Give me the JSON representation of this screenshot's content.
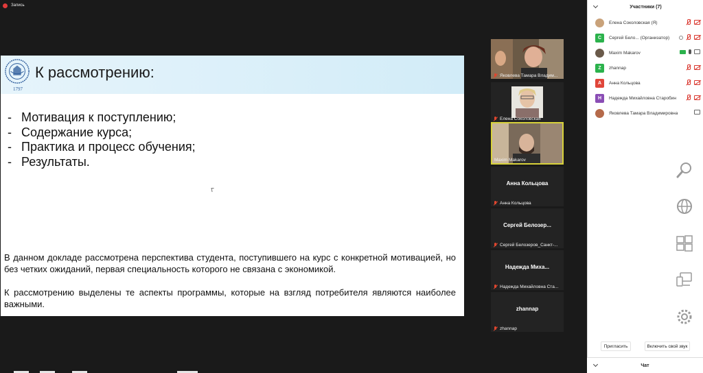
{
  "recording": {
    "label": "Запись",
    "color": "#e03a3a"
  },
  "slide": {
    "year": "1797",
    "title": "К рассмотрению:",
    "bullets": [
      {
        "marker": "-",
        "text": "Мотивация к поступлению;"
      },
      {
        "marker": "-",
        "text": "Содержание курса;"
      },
      {
        "marker": "-",
        "text": "Практика и процесс обучения;"
      },
      {
        "marker": "-",
        "text": "Результаты."
      }
    ],
    "paragraph1": "В данном докладе рассмотрена перспектива студента, поступившего на курс с конкретной мотивацией, но без четких ожиданий, первая специальность которого не связана с экономикой.",
    "paragraph2": "К рассмотрению выделены те аспекты программы, которые на взгляд потребителя являются наиболее важными."
  },
  "tiles": [
    {
      "label": "Яковлева Тамара Владим...",
      "name": ""
    },
    {
      "label": "Елена Соколовская",
      "name": ""
    },
    {
      "label": "Maxim Makarov",
      "name": ""
    },
    {
      "label": "Анна Кольцова",
      "name": "Анна Кольцова"
    },
    {
      "label": "Сергей Белозеров_Санкт-...",
      "name": "Сергей  Белозер..."
    },
    {
      "label": "Надежда Михайловна Ста...",
      "name": "Надежда  Миха..."
    },
    {
      "label": "zhannap",
      "name": "zhannap"
    }
  ],
  "participants": {
    "title": "Участники (7)",
    "items": [
      {
        "avatar": "",
        "avatar_color": "#c9a27a",
        "name": "Елена Соколовская (Я)"
      },
      {
        "avatar": "С",
        "avatar_color": "#2bb24c",
        "name": "Сергей Бело... (Организатор)"
      },
      {
        "avatar": "",
        "avatar_color": "#6a5a4a",
        "name": "Maxim Makarov"
      },
      {
        "avatar": "Z",
        "avatar_color": "#2bb24c",
        "name": "zhannap"
      },
      {
        "avatar": "А",
        "avatar_color": "#e0463a",
        "name": "Анна Кольцова"
      },
      {
        "avatar": "Н",
        "avatar_color": "#8a4db5",
        "name": "Надежда Михайловна Старобинская"
      },
      {
        "avatar": "",
        "avatar_color": "#b56a4a",
        "name": "Яковлева Тамара Владимировна"
      }
    ],
    "invite_label": "Пригласить",
    "unmute_label": "Включить свой звук"
  },
  "chat": {
    "title": "Чат"
  },
  "side_icons": [
    "magnifier-icon",
    "globe-icon",
    "windows-logo-icon",
    "devices-icon",
    "gear-icon"
  ]
}
